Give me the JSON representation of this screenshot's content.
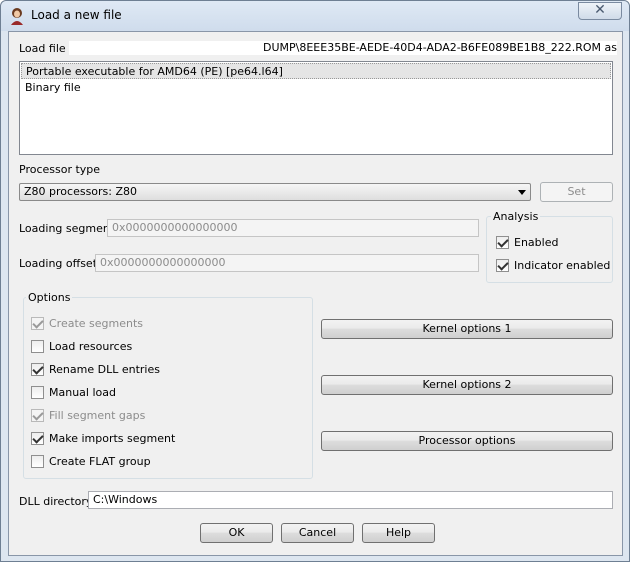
{
  "window": {
    "title": "Load a new file",
    "close_glyph": "✕"
  },
  "load_file": {
    "label": "Load file",
    "path": "DUMP\\8EEE35BE-AEDE-40D4-ADA2-B6FE089BE1B8_222.ROM as"
  },
  "loaders": [
    {
      "label": "Portable executable for AMD64 (PE) [pe64.l64]",
      "selected": true
    },
    {
      "label": "Binary file",
      "selected": false
    }
  ],
  "processor": {
    "label": "Processor type",
    "selected": "Z80 processors: Z80",
    "set_button": "Set"
  },
  "loading_segment": {
    "label": "Loading segment",
    "value": "0x0000000000000000"
  },
  "loading_offset": {
    "label": "Loading offset",
    "value": "0x0000000000000000"
  },
  "analysis": {
    "title": "Analysis",
    "enabled": {
      "label": "Enabled",
      "checked": true
    },
    "indicator": {
      "label": "Indicator enabled",
      "checked": true
    }
  },
  "options": {
    "title": "Options",
    "items": [
      {
        "label": "Create segments",
        "checked": true,
        "disabled": true
      },
      {
        "label": "Load resources",
        "checked": false,
        "disabled": false
      },
      {
        "label": "Rename DLL entries",
        "checked": true,
        "disabled": false
      },
      {
        "label": "Manual load",
        "checked": false,
        "disabled": false
      },
      {
        "label": "Fill segment gaps",
        "checked": true,
        "disabled": true
      },
      {
        "label": "Make imports segment",
        "checked": true,
        "disabled": false
      },
      {
        "label": "Create FLAT group",
        "checked": false,
        "disabled": false
      }
    ]
  },
  "side_buttons": {
    "kernel1": "Kernel options 1",
    "kernel2": "Kernel options 2",
    "processor": "Processor options"
  },
  "dll_directory": {
    "label": "DLL directory",
    "value": "C:\\Windows"
  },
  "footer": {
    "ok": "OK",
    "cancel": "Cancel",
    "help": "Help"
  },
  "colors": {
    "selection": "#e5e5e5",
    "window_frame": "#dde6f0",
    "dialog_bg": "#f0f0f0"
  }
}
